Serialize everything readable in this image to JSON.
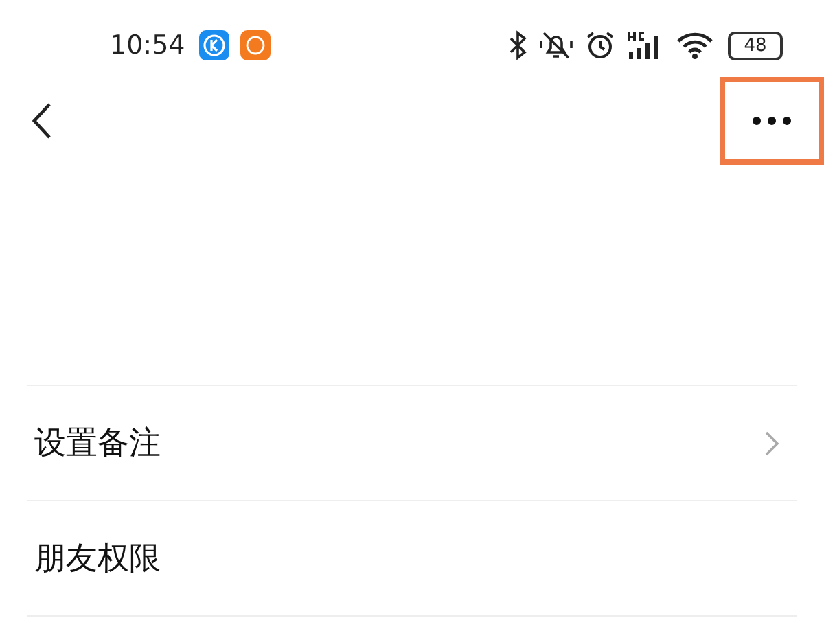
{
  "status_bar": {
    "time": "10:54",
    "battery": "48"
  },
  "nav": {
    "highlighted_more": true
  },
  "rows": [
    {
      "label": "设置备注",
      "chevron": true
    },
    {
      "label": "朋友权限",
      "chevron": false
    }
  ]
}
